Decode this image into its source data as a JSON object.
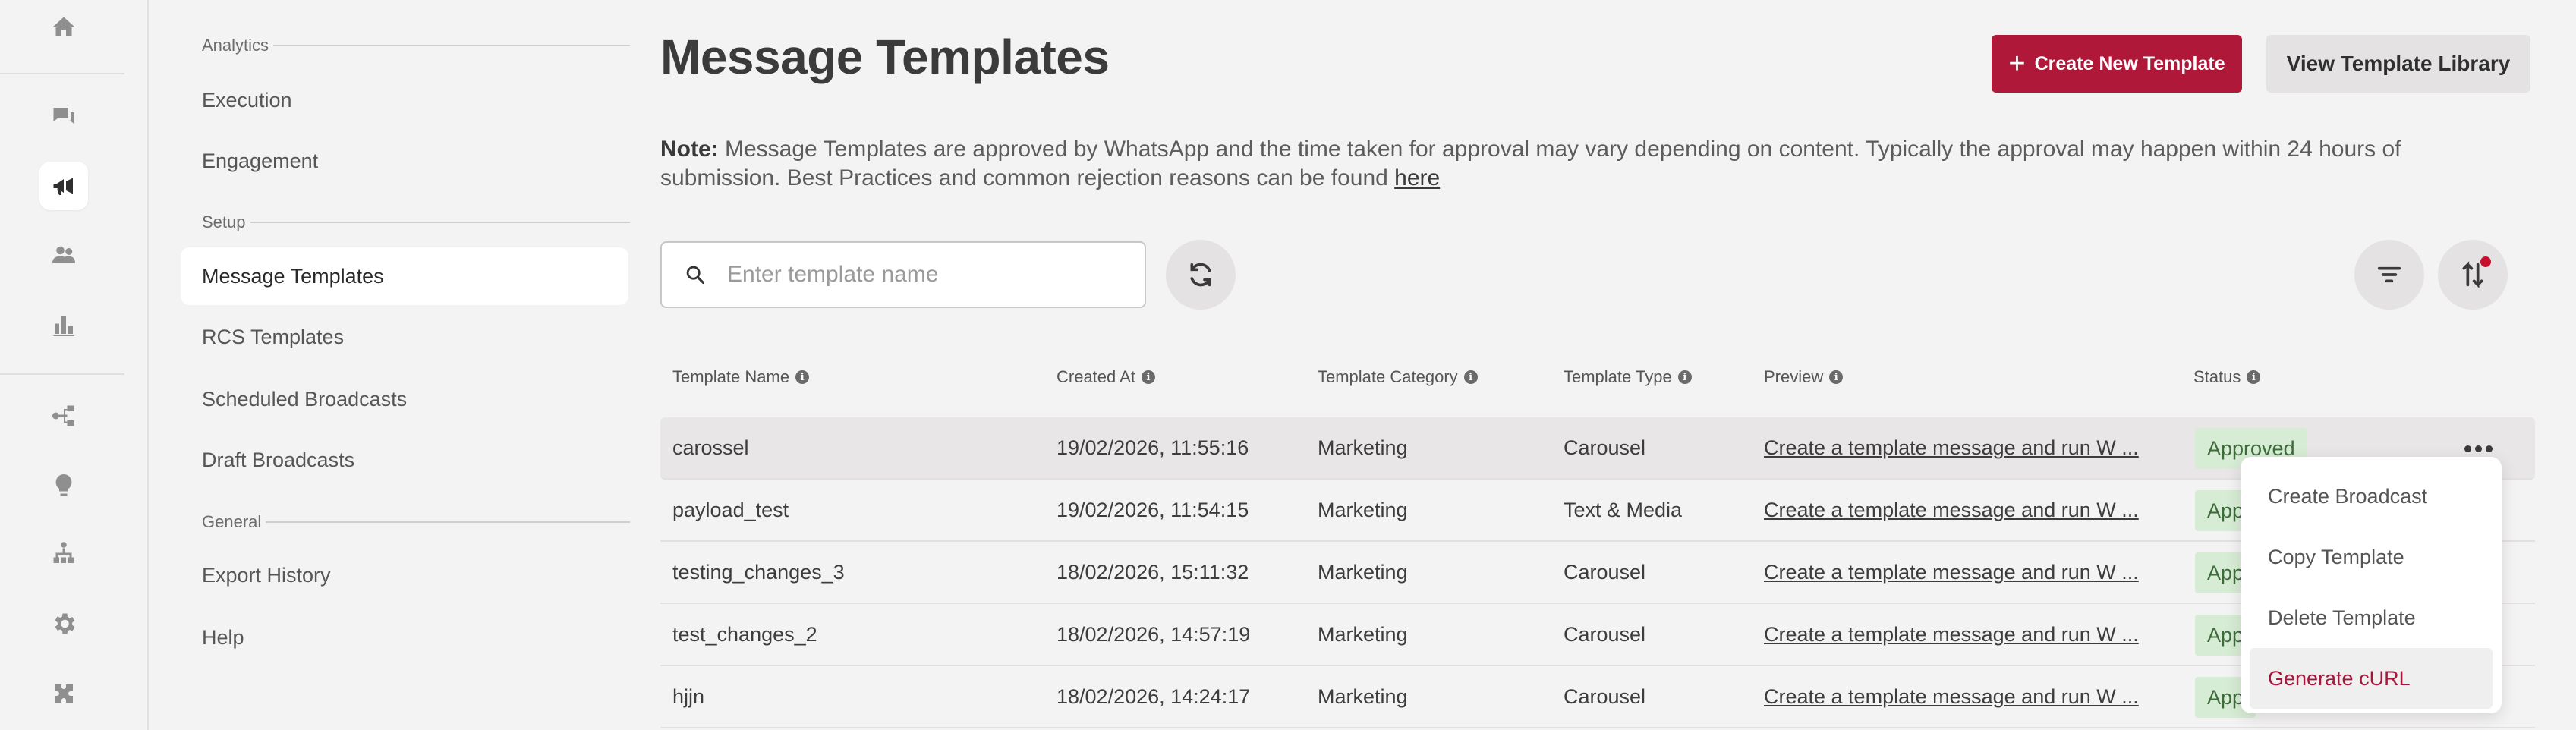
{
  "icons": {
    "rail": [
      "home-icon",
      "chat-icon",
      "megaphone-icon",
      "users-icon",
      "bar-chart-icon",
      "flow-icon",
      "bulb-icon",
      "org-icon",
      "gear-icon",
      "puzzle-icon"
    ]
  },
  "sidebar": {
    "sections": {
      "analytics": "Analytics",
      "setup": "Setup",
      "general": "General"
    },
    "items": {
      "execution": "Execution",
      "engagement": "Engagement",
      "message_templates": "Message Templates",
      "rcs_templates": "RCS Templates",
      "scheduled_broadcasts": "Scheduled Broadcasts",
      "draft_broadcasts": "Draft Broadcasts",
      "export_history": "Export History",
      "help": "Help"
    }
  },
  "header": {
    "title": "Message Templates",
    "create_button": "Create New Template",
    "library_button": "View Template Library"
  },
  "note": {
    "label": "Note:",
    "text": " Message Templates are approved by WhatsApp and the time taken for approval may vary depending on content. Typically the approval may happen within 24 hours of submission. Best Practices and common rejection reasons can be found ",
    "link": "here"
  },
  "search": {
    "placeholder": "Enter template name",
    "value": ""
  },
  "table": {
    "columns": [
      "Template Name",
      "Created At",
      "Template Category",
      "Template Type",
      "Preview",
      "Status"
    ],
    "rows": [
      [
        "carossel",
        "19/02/2026, 11:55:16",
        "Marketing",
        "Carousel",
        "Create a template message and run W ...",
        "Approved"
      ],
      [
        "payload_test",
        "19/02/2026, 11:54:15",
        "Marketing",
        "Text & Media",
        "Create a template message and run W ...",
        "Appr"
      ],
      [
        "testing_changes_3",
        "18/02/2026, 15:11:32",
        "Marketing",
        "Carousel",
        "Create a template message and run W ...",
        "App"
      ],
      [
        "test_changes_2",
        "18/02/2026, 14:57:19",
        "Marketing",
        "Carousel",
        "Create a template message and run W ...",
        "App"
      ],
      [
        "hjjn",
        "18/02/2026, 14:24:17",
        "Marketing",
        "Carousel",
        "Create a template message and run W ...",
        "App"
      ]
    ]
  },
  "menu": {
    "items": [
      "Create Broadcast",
      "Copy Template",
      "Delete Template",
      "Generate cURL"
    ]
  },
  "colors": {
    "primary": "#b01839",
    "status_bg": "#d7ecd5",
    "status_text": "#3d6b3a",
    "menu_highlight": "#a3173a",
    "badge_dot": "#c8102e"
  }
}
